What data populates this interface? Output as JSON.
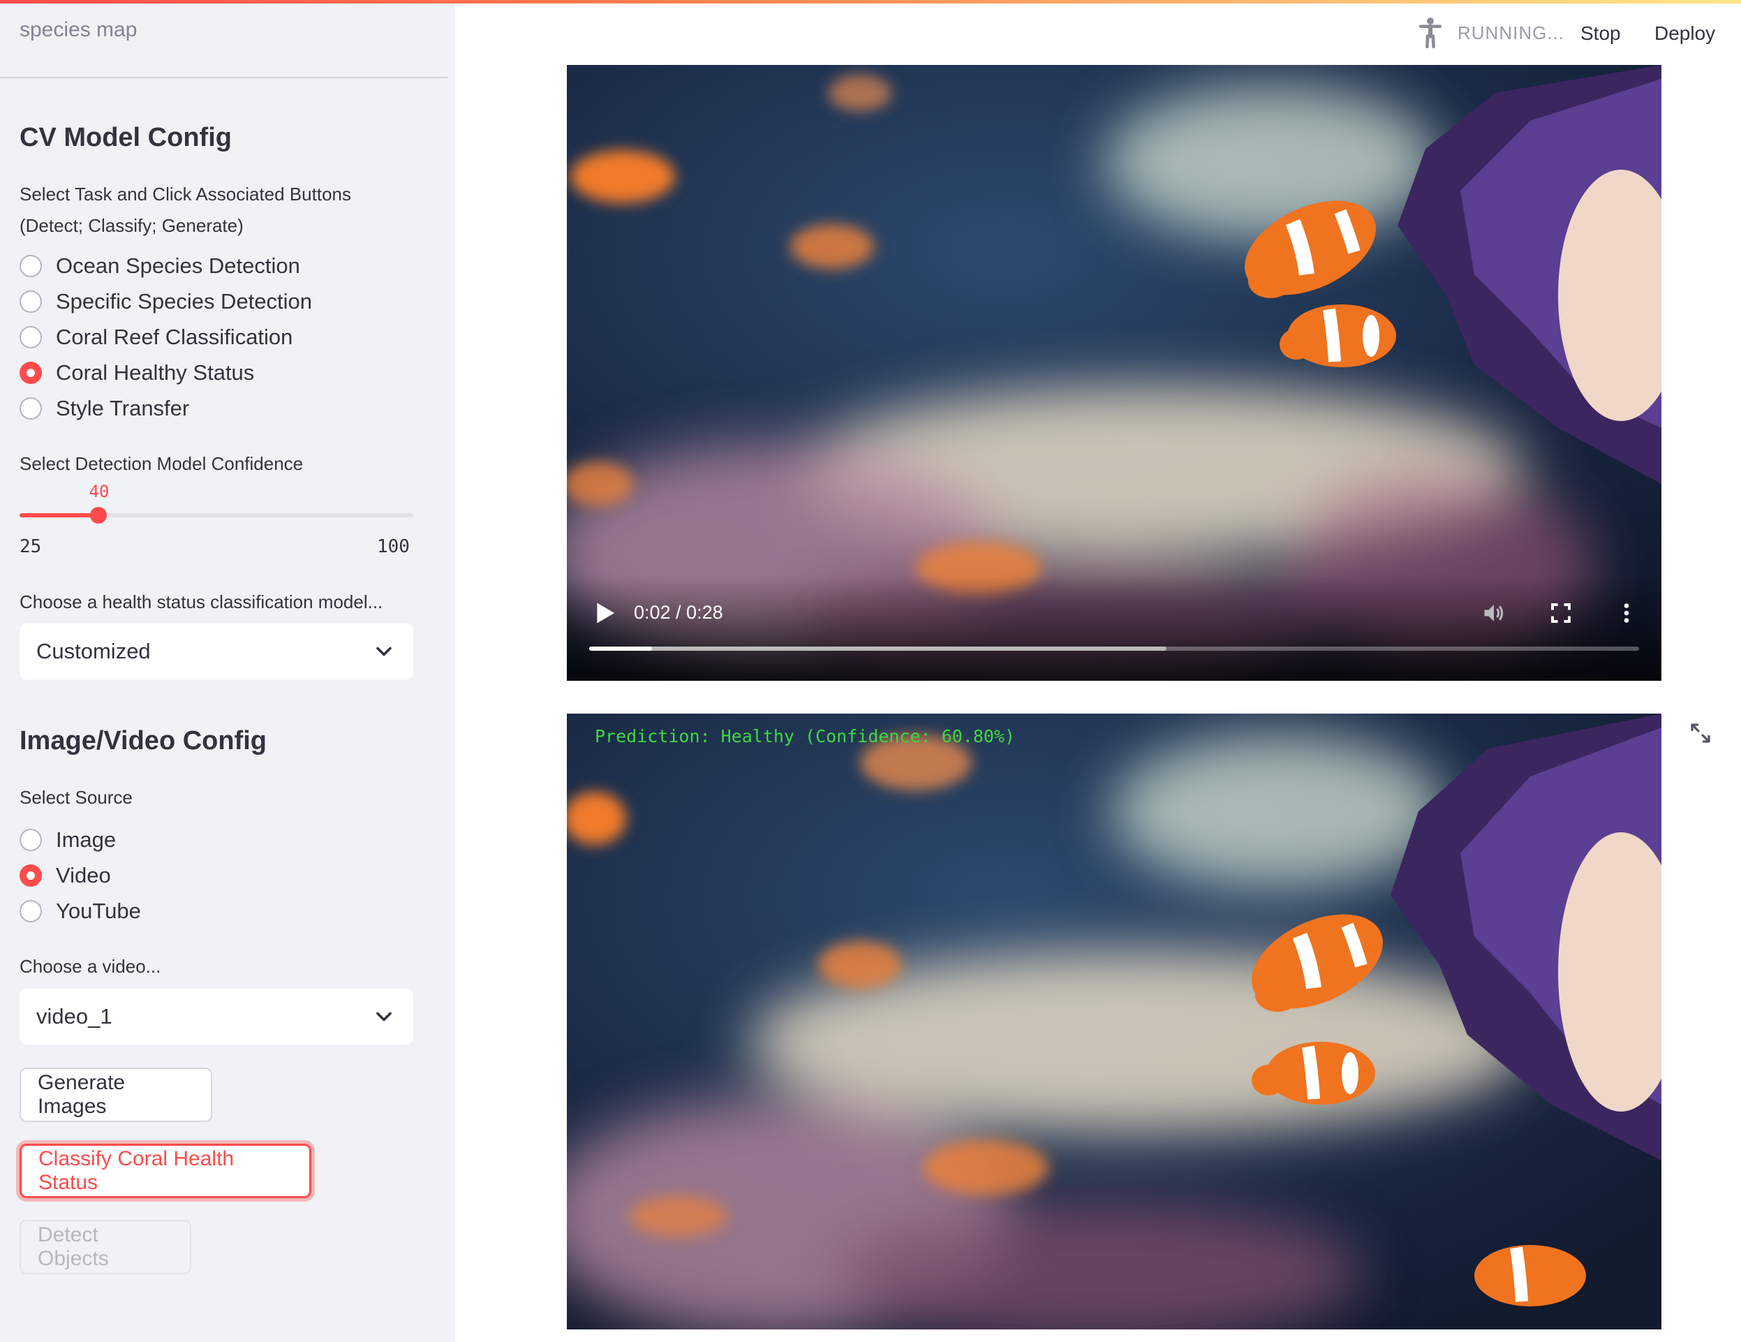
{
  "app": {
    "name": "species map"
  },
  "header": {
    "status": "RUNNING...",
    "stop_label": "Stop",
    "deploy_label": "Deploy"
  },
  "sidebar": {
    "cv_title": "CV Model Config",
    "task_label_line1": "Select Task and Click Associated Buttons",
    "task_label_line2": "(Detect; Classify; Generate)",
    "tasks": [
      {
        "label": "Ocean Species Detection",
        "selected": false
      },
      {
        "label": "Specific Species Detection",
        "selected": false
      },
      {
        "label": "Coral Reef Classification",
        "selected": false
      },
      {
        "label": "Coral Healthy Status",
        "selected": true
      },
      {
        "label": "Style Transfer",
        "selected": false
      }
    ],
    "confidence": {
      "label": "Select Detection Model Confidence",
      "value": "40",
      "min": "25",
      "max": "100"
    },
    "health_model": {
      "label": "Choose a health status classification model...",
      "selected": "Customized"
    },
    "media_title": "Image/Video Config",
    "source_label": "Select Source",
    "sources": [
      {
        "label": "Image",
        "selected": false
      },
      {
        "label": "Video",
        "selected": true
      },
      {
        "label": "YouTube",
        "selected": false
      }
    ],
    "video_select": {
      "label": "Choose a video...",
      "selected": "video_1"
    },
    "buttons": {
      "generate": "Generate Images",
      "classify": "Classify Coral Health Status",
      "detect": "Detect Objects"
    }
  },
  "video": {
    "time": "0:02 / 0:28",
    "played_fraction": 0.06,
    "buffered_fraction": 0.55
  },
  "result": {
    "prediction_text": "Prediction: Healthy (Confidence: 60.80%)"
  },
  "colors": {
    "accent": "#ff4b4b",
    "sidebar_bg": "#f0f2f6",
    "prediction_green": "#3ed93e"
  },
  "icons": {
    "running": "running-man-icon",
    "play": "play-icon",
    "volume": "volume-icon",
    "fullscreen": "fullscreen-icon",
    "more": "more-vertical-icon",
    "expand": "expand-icon",
    "chevron": "chevron-down-icon"
  }
}
